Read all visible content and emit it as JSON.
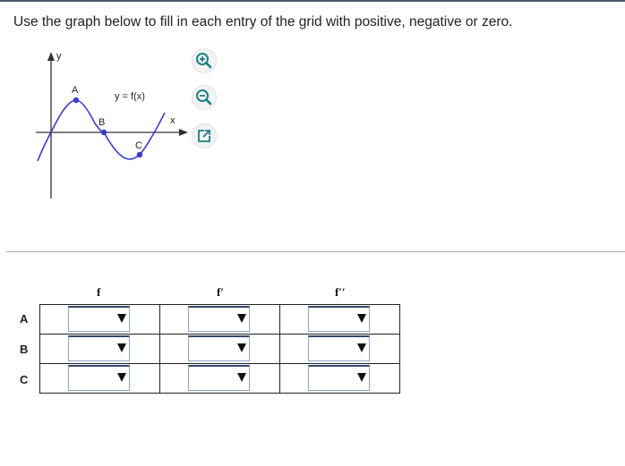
{
  "instructions": "Use the graph below to fill in each entry of the grid with positive, negative or zero.",
  "graph": {
    "y_axis_label": "y",
    "x_axis_label": "x",
    "function_label": "y = f(x)",
    "points": [
      {
        "label": "A"
      },
      {
        "label": "B"
      },
      {
        "label": "C"
      }
    ],
    "curve_color": "#3b3bd0"
  },
  "toolbar": {
    "zoom_in_icon": "zoom-in-icon",
    "zoom_out_icon": "zoom-out-icon",
    "popout_icon": "external-link-icon",
    "icon_color": "#1b7f86"
  },
  "grid": {
    "columns": [
      "f",
      "f′",
      "f′′"
    ],
    "rows": [
      {
        "label": "A",
        "values": [
          "",
          "",
          ""
        ]
      },
      {
        "label": "B",
        "values": [
          "",
          "",
          ""
        ]
      },
      {
        "label": "C",
        "values": [
          "",
          "",
          ""
        ]
      }
    ]
  }
}
